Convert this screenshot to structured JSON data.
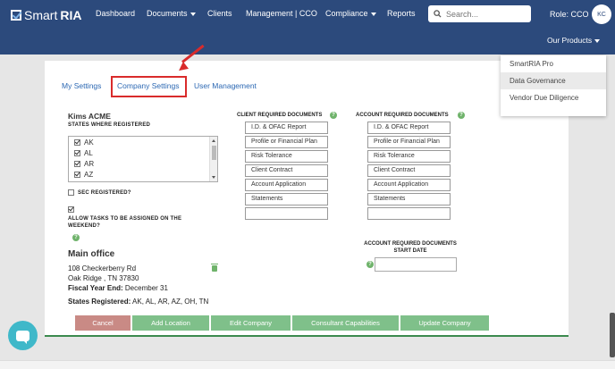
{
  "brand": {
    "name_light": "Smart",
    "name_bold": "RIA"
  },
  "nav": {
    "items": [
      "Dashboard",
      "Documents",
      "Clients",
      "Management | CCO",
      "Compliance",
      "Reports"
    ],
    "search_placeholder": "Search...",
    "role": "Role: CCO",
    "avatar": "KC",
    "products": "Our Products"
  },
  "products_menu": [
    "SmartRIA Pro",
    "Data Governance",
    "Vendor Due Diligence"
  ],
  "tabs": [
    "My Settings",
    "Company Settings",
    "User Management"
  ],
  "company": {
    "name": "Kims ACME",
    "states_label": "STATES WHERE REGISTERED",
    "states": [
      "AK",
      "AL",
      "AR",
      "AZ"
    ],
    "sec_label": "SEC REGISTERED?",
    "weekend_label": "ALLOW TASKS TO BE ASSIGNED ON THE WEEKEND?"
  },
  "client_docs": {
    "title": "CLIENT REQUIRED DOCUMENTS",
    "items": [
      "I.D. & OFAC Report",
      "Profile or Financial Plan",
      "Risk Tolerance",
      "Client Contract",
      "Account Application",
      "Statements",
      ""
    ]
  },
  "account_docs": {
    "title": "ACCOUNT REQUIRED DOCUMENTS",
    "items": [
      "I.D. & OFAC Report",
      "Profile or Financial Plan",
      "Risk Tolerance",
      "Client Contract",
      "Account Application",
      "Statements",
      ""
    ],
    "start_date_title": "ACCOUNT REQUIRED DOCUMENTS START DATE"
  },
  "office": {
    "title": "Main office",
    "address1": "108 Checkerberry Rd",
    "address2": "Oak Ridge , TN 37830",
    "fiscal_label": "Fiscal Year End:",
    "fiscal_value": "December 31",
    "states_label": "States Registered:",
    "states_value": "AK, AL, AR, AZ, OH, TN"
  },
  "buttons": [
    "Cancel",
    "Add Location",
    "Edit Company",
    "Consultant Capabilities",
    "Update Company"
  ],
  "colors": {
    "navbar": "#2c4a7c",
    "accent_green": "#7fc08a",
    "cancel_red": "#c98a85",
    "highlight_red": "#d92b2b"
  }
}
